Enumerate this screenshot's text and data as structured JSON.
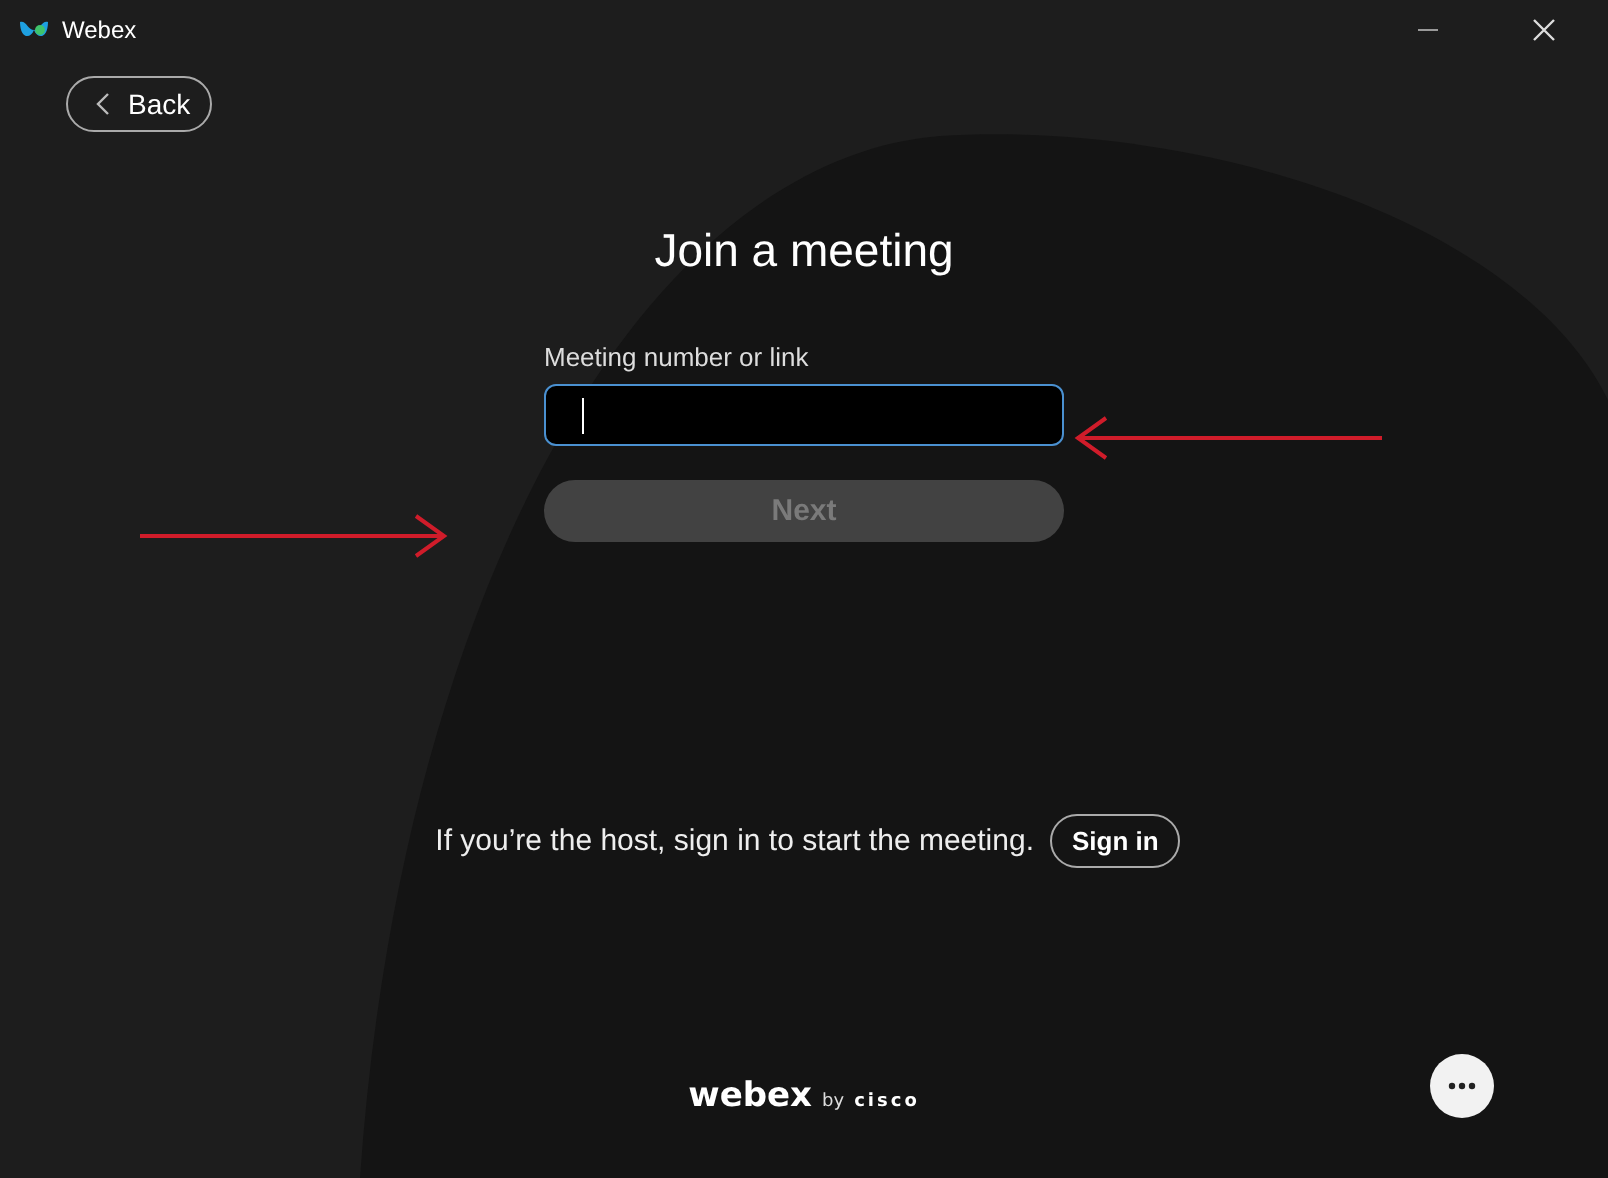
{
  "window": {
    "title": "Webex"
  },
  "back_button": {
    "label": "Back"
  },
  "heading": "Join a meeting",
  "meeting_field": {
    "label": "Meeting number or link",
    "focused": true
  },
  "next_button": {
    "label": "Next",
    "disabled": true
  },
  "host_prompt": {
    "text": "If you’re the host, sign in to start the meeting.",
    "button": "Sign in"
  },
  "footer_logo": {
    "brand": "webex",
    "by": "by",
    "company": "cisco"
  }
}
